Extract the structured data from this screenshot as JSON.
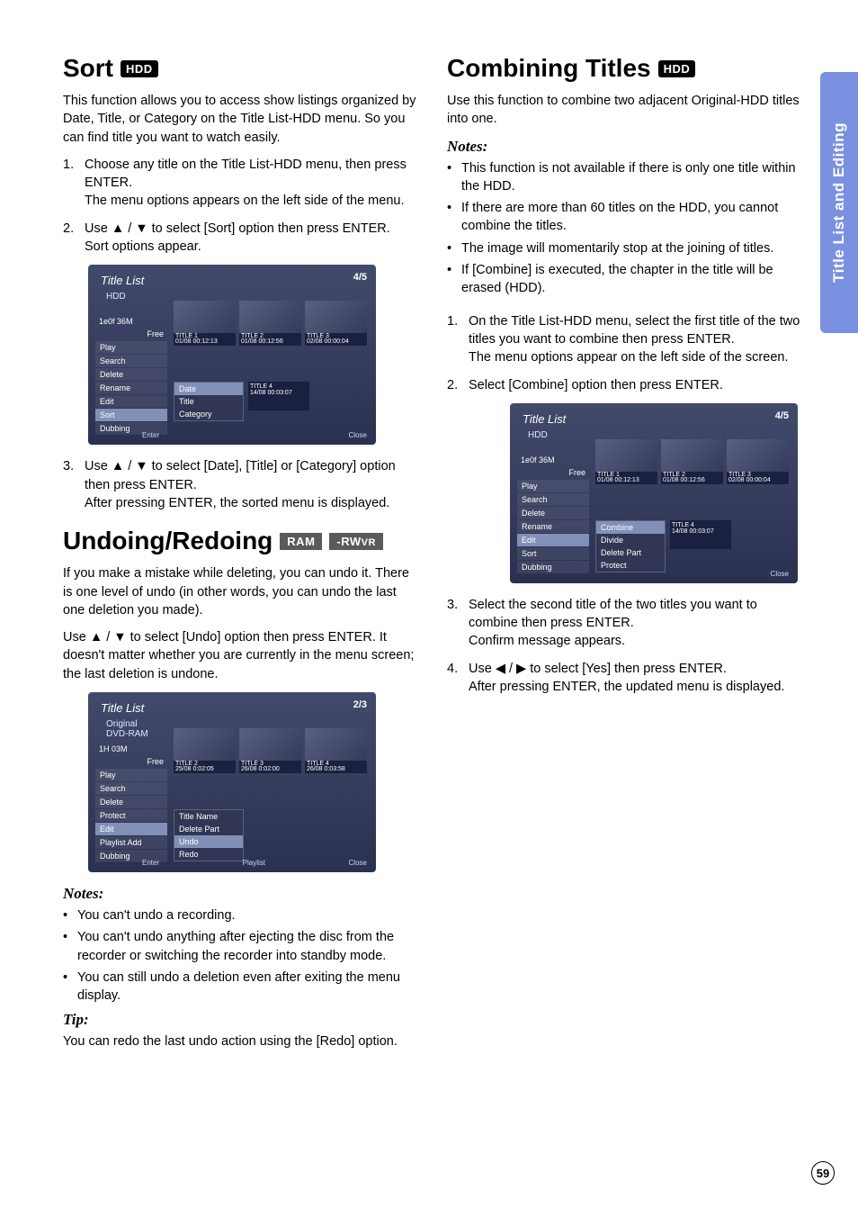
{
  "sidetab": "Title List and Editing",
  "page_number": "59",
  "left": {
    "sort": {
      "title": "Sort",
      "badge": "HDD",
      "intro": "This function allows you to access show listings organized by Date, Title, or Category on the Title List-HDD menu. So you can find title you want to watch easily.",
      "steps": [
        {
          "n": "1.",
          "text": "Choose any title on the Title List-HDD menu, then press ENTER.",
          "text2": "The menu options appears on the left side of the menu."
        },
        {
          "n": "2.",
          "text": "Use ▲ / ▼ to select [Sort] option then press ENTER.",
          "text2": "Sort options appear."
        },
        {
          "n": "3.",
          "text": "Use ▲ / ▼ to select [Date], [Title] or [Category] option then press ENTER.",
          "text2": "After pressing ENTER, the sorted menu is displayed."
        }
      ],
      "screenshot": {
        "header": "Title List",
        "sub": "HDD",
        "counter": "4/5",
        "side_top1": "1e0f 36M",
        "side_top2": "Free",
        "sidebar": [
          "Play",
          "Search",
          "Delete",
          "Rename",
          "Edit",
          "Sort",
          "Dubbing"
        ],
        "submenu": [
          "Date",
          "Title",
          "Category"
        ],
        "thumbs": [
          "TITLE 1",
          "TITLE 2",
          "TITLE 3"
        ],
        "thumbs_sub": [
          "01/08  00:12:13",
          "01/08  00:12:56",
          "02/08  00:00:04"
        ],
        "extra_thumb": "TITLE 4",
        "extra_sub": "14/08  00:03:07",
        "footer_left": "Enter",
        "footer_right": "Close"
      }
    },
    "undo": {
      "title": "Undoing/Redoing",
      "badge1": "RAM",
      "badge2": "-RW",
      "badge2sub": "VR",
      "intro": "If you make a mistake while deleting, you can undo it. There is one level of undo (in other words, you can undo the last one deletion you made).",
      "use": "Use ▲ / ▼ to select [Undo] option then press ENTER. It doesn't matter whether you are currently in the menu screen; the last deletion is undone.",
      "screenshot": {
        "header": "Title List",
        "sub1": "Original",
        "sub2": "DVD-RAM",
        "counter": "2/3",
        "side_top1": "1H 03M",
        "side_top2": "Free",
        "sidebar": [
          "Play",
          "Search",
          "Delete",
          "Protect",
          "Edit",
          "Playlist Add",
          "Dubbing"
        ],
        "submenu": [
          "Title Name",
          "Delete Part",
          "Undo",
          "Redo"
        ],
        "thumbs": [
          "TITLE 2",
          "TITLE 3",
          "TITLE 4"
        ],
        "thumbs_sub": [
          "25/08  0:02:05",
          "26/08  0:02:00",
          "26/08  0:03:58"
        ],
        "footer_left": "Enter",
        "footer_mid": "Playlist",
        "footer_right": "Close"
      },
      "notes_title": "Notes:",
      "notes": [
        "You can't undo a recording.",
        "You can't undo anything after ejecting the disc from the recorder or switching the recorder into standby mode.",
        "You can still undo a deletion even after exiting the menu display."
      ],
      "tip_title": "Tip:",
      "tip": "You can redo the last undo action using the [Redo] option."
    }
  },
  "right": {
    "combine": {
      "title": "Combining Titles",
      "badge": "HDD",
      "intro": "Use this function to combine two adjacent Original-HDD titles into one.",
      "notes_title": "Notes:",
      "notes": [
        "This function is not available if there is only one title within the HDD.",
        "If there are more than 60 titles on the HDD, you cannot combine the titles.",
        "The image will momentarily stop at the joining of titles.",
        "If [Combine] is executed, the chapter in the title will be erased (HDD)."
      ],
      "steps_a": [
        {
          "n": "1.",
          "text": "On the Title List-HDD menu, select the first title of the two titles you want to combine then press ENTER.",
          "text2": "The menu options appear on the left side of the screen."
        },
        {
          "n": "2.",
          "text": "Select [Combine] option then press ENTER."
        }
      ],
      "screenshot": {
        "header": "Title List",
        "sub": "HDD",
        "counter": "4/5",
        "side_top1": "1e0f 36M",
        "side_top2": "Free",
        "sidebar": [
          "Play",
          "Search",
          "Delete",
          "Rename",
          "Edit",
          "Sort",
          "Dubbing"
        ],
        "submenu": [
          "Combine",
          "Divide",
          "Delete Part",
          "Protect"
        ],
        "thumbs": [
          "TITLE 1",
          "TITLE 2",
          "TITLE 3"
        ],
        "thumbs_sub": [
          "01/08  00:12:13",
          "01/08  00:12:56",
          "02/08  00:00:04"
        ],
        "extra_thumb": "TITLE 4",
        "extra_sub": "14/08  00:03:07",
        "footer_left": "",
        "footer_right": "Close"
      },
      "steps_b": [
        {
          "n": "3.",
          "text": "Select the second title of the two titles you want to combine then press ENTER.",
          "text2": "Confirm message appears."
        },
        {
          "n": "4.",
          "text": "Use ◀ / ▶ to select [Yes] then press ENTER.",
          "text2": "After pressing ENTER, the updated menu is displayed."
        }
      ]
    }
  }
}
